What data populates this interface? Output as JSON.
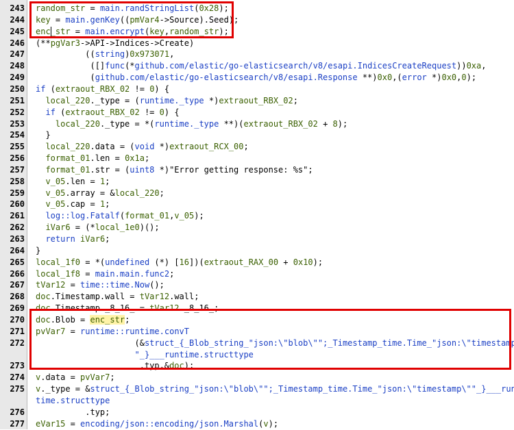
{
  "lines": [
    {
      "n": "243",
      "segs": [
        [
          "random_str",
          "t-var"
        ],
        [
          " = ",
          ""
        ],
        [
          "main.randStringList",
          "t-func"
        ],
        [
          "(",
          ""
        ],
        [
          "0x28",
          "t-num"
        ],
        [
          ");",
          ""
        ]
      ]
    },
    {
      "n": "244",
      "segs": [
        [
          "key",
          "t-var"
        ],
        [
          " = ",
          ""
        ],
        [
          "main.genKey",
          "t-func"
        ],
        [
          "((",
          ""
        ],
        [
          "pmVar4",
          "t-var"
        ],
        [
          "->Source).Seed);",
          ""
        ]
      ]
    },
    {
      "n": "245",
      "segs": [
        [
          "enc_str",
          "t-var"
        ],
        [
          " = ",
          ""
        ],
        [
          "main.encrypt",
          "t-func"
        ],
        [
          "(",
          ""
        ],
        [
          "key",
          "t-var"
        ],
        [
          ",",
          ""
        ],
        [
          "random_str",
          "t-var"
        ],
        [
          ");",
          ""
        ]
      ]
    },
    {
      "n": "246",
      "segs": [
        [
          "(**",
          ""
        ],
        [
          "pgVar3",
          "t-var"
        ],
        [
          "->API->Indices->Create)",
          ""
        ]
      ]
    },
    {
      "n": "247",
      "segs": [
        [
          "          ((",
          ""
        ],
        [
          "string",
          "t-type"
        ],
        [
          ")",
          ""
        ],
        [
          "0x973071",
          "t-num"
        ],
        [
          ",",
          ""
        ]
      ]
    },
    {
      "n": "248",
      "segs": [
        [
          "           ([]",
          ""
        ],
        [
          "func",
          "t-kw"
        ],
        [
          "(*",
          ""
        ],
        [
          "github.com/elastic/go-elasticsearch/v8/esapi.IndicesCreateRequest",
          "t-type"
        ],
        [
          "))",
          ""
        ],
        [
          "0xa",
          "t-num"
        ],
        [
          ",",
          ""
        ]
      ]
    },
    {
      "n": "249",
      "segs": [
        [
          "           (",
          ""
        ],
        [
          "github.com/elastic/go-elasticsearch/v8/esapi.Response",
          "t-type"
        ],
        [
          " **)",
          ""
        ],
        [
          "0x0",
          "t-num"
        ],
        [
          ",(",
          ""
        ],
        [
          "error",
          "t-type"
        ],
        [
          " *)",
          ""
        ],
        [
          "0x0",
          "t-num"
        ],
        [
          ",",
          ""
        ],
        [
          "0",
          "t-num"
        ],
        [
          ");",
          ""
        ]
      ]
    },
    {
      "n": "250",
      "segs": [
        [
          "if",
          "t-kw"
        ],
        [
          " (",
          ""
        ],
        [
          "extraout_RBX_02",
          "t-var"
        ],
        [
          " != ",
          ""
        ],
        [
          "0",
          "t-num"
        ],
        [
          ") {",
          ""
        ]
      ]
    },
    {
      "n": "251",
      "segs": [
        [
          "  ",
          ""
        ],
        [
          "local_220",
          "t-var"
        ],
        [
          "._type = (",
          ""
        ],
        [
          "runtime._type",
          "t-type"
        ],
        [
          " *)",
          ""
        ],
        [
          "extraout_RBX_02",
          "t-var"
        ],
        [
          ";",
          ""
        ]
      ]
    },
    {
      "n": "252",
      "segs": [
        [
          "  ",
          ""
        ],
        [
          "if",
          "t-kw"
        ],
        [
          " (",
          ""
        ],
        [
          "extraout_RBX_02",
          "t-var"
        ],
        [
          " != ",
          ""
        ],
        [
          "0",
          "t-num"
        ],
        [
          ") {",
          ""
        ]
      ]
    },
    {
      "n": "253",
      "segs": [
        [
          "    ",
          ""
        ],
        [
          "local_220",
          "t-var"
        ],
        [
          "._type = *(",
          ""
        ],
        [
          "runtime._type",
          "t-type"
        ],
        [
          " **)(",
          ""
        ],
        [
          "extraout_RBX_02",
          "t-var"
        ],
        [
          " + ",
          ""
        ],
        [
          "8",
          "t-num"
        ],
        [
          ");",
          ""
        ]
      ]
    },
    {
      "n": "254",
      "segs": [
        [
          "  }",
          ""
        ]
      ]
    },
    {
      "n": "255",
      "segs": [
        [
          "  ",
          ""
        ],
        [
          "local_220",
          "t-var"
        ],
        [
          ".data = (",
          ""
        ],
        [
          "void",
          "t-type"
        ],
        [
          " *)",
          ""
        ],
        [
          "extraout_RCX_00",
          "t-var"
        ],
        [
          ";",
          ""
        ]
      ]
    },
    {
      "n": "256",
      "segs": [
        [
          "  ",
          ""
        ],
        [
          "format_01",
          "t-var"
        ],
        [
          ".len = ",
          ""
        ],
        [
          "0x1a",
          "t-num"
        ],
        [
          ";",
          ""
        ]
      ]
    },
    {
      "n": "257",
      "segs": [
        [
          "  ",
          ""
        ],
        [
          "format_01",
          "t-var"
        ],
        [
          ".str = (",
          ""
        ],
        [
          "uint8",
          "t-type"
        ],
        [
          " *)\"Error getting response: %s\";",
          ""
        ]
      ]
    },
    {
      "n": "258",
      "segs": [
        [
          "  ",
          ""
        ],
        [
          "v_05",
          "t-var"
        ],
        [
          ".len = ",
          ""
        ],
        [
          "1",
          "t-num"
        ],
        [
          ";",
          ""
        ]
      ]
    },
    {
      "n": "259",
      "segs": [
        [
          "  ",
          ""
        ],
        [
          "v_05",
          "t-var"
        ],
        [
          ".array = &",
          ""
        ],
        [
          "local_220",
          "t-var"
        ],
        [
          ";",
          ""
        ]
      ]
    },
    {
      "n": "260",
      "segs": [
        [
          "  ",
          ""
        ],
        [
          "v_05",
          "t-var"
        ],
        [
          ".cap = ",
          ""
        ],
        [
          "1",
          "t-num"
        ],
        [
          ";",
          ""
        ]
      ]
    },
    {
      "n": "261",
      "segs": [
        [
          "  ",
          ""
        ],
        [
          "log::log.Fatalf",
          "t-func"
        ],
        [
          "(",
          ""
        ],
        [
          "format_01",
          "t-var"
        ],
        [
          ",",
          ""
        ],
        [
          "v_05",
          "t-var"
        ],
        [
          ");",
          ""
        ]
      ]
    },
    {
      "n": "262",
      "segs": [
        [
          "  ",
          ""
        ],
        [
          "iVar6",
          "t-var"
        ],
        [
          " = (*",
          ""
        ],
        [
          "local_1e0",
          "t-var"
        ],
        [
          ")();",
          ""
        ]
      ]
    },
    {
      "n": "263",
      "segs": [
        [
          "  ",
          ""
        ],
        [
          "return",
          "t-kw"
        ],
        [
          " ",
          ""
        ],
        [
          "iVar6",
          "t-var"
        ],
        [
          ";",
          ""
        ]
      ]
    },
    {
      "n": "264",
      "segs": [
        [
          "}",
          ""
        ]
      ]
    },
    {
      "n": "265",
      "segs": [
        [
          "local_1f0",
          "t-var"
        ],
        [
          " = *(",
          ""
        ],
        [
          "undefined",
          "t-type"
        ],
        [
          " (*) [",
          ""
        ],
        [
          "16",
          "t-num"
        ],
        [
          "])(",
          ""
        ],
        [
          "extraout_RAX_00",
          "t-var"
        ],
        [
          " + ",
          ""
        ],
        [
          "0x10",
          "t-num"
        ],
        [
          ");",
          ""
        ]
      ]
    },
    {
      "n": "266",
      "segs": [
        [
          "local_1f8",
          "t-var"
        ],
        [
          " = ",
          ""
        ],
        [
          "main.main.func2",
          "t-func"
        ],
        [
          ";",
          ""
        ]
      ]
    },
    {
      "n": "267",
      "segs": [
        [
          "tVar12",
          "t-var"
        ],
        [
          " = ",
          ""
        ],
        [
          "time::time.Now",
          "t-func"
        ],
        [
          "();",
          ""
        ]
      ]
    },
    {
      "n": "268",
      "segs": [
        [
          "doc",
          "t-var"
        ],
        [
          ".Timestamp.wall = ",
          ""
        ],
        [
          "tVar12",
          "t-var"
        ],
        [
          ".wall;",
          ""
        ]
      ]
    },
    {
      "n": "269",
      "segs": [
        [
          "doc",
          "t-var"
        ],
        [
          ".Timestamp._8_16_ = ",
          ""
        ],
        [
          "tVar12",
          "t-var"
        ],
        [
          "._8_16_;",
          ""
        ]
      ]
    },
    {
      "n": "270",
      "segs": [
        [
          "doc",
          "t-var"
        ],
        [
          ".Blob = ",
          ""
        ],
        [
          "enc_str",
          "t-var enc-hl"
        ],
        [
          ";",
          ""
        ]
      ]
    },
    {
      "n": "271",
      "segs": [
        [
          "pvVar7",
          "t-var"
        ],
        [
          " = ",
          ""
        ],
        [
          "runtime::runtime.convT",
          "t-func"
        ]
      ]
    },
    {
      "n": "272",
      "segs": [
        [
          "                    (&",
          ""
        ],
        [
          "struct_{_Blob_string_\"json:\\\"blob\\\"\";_Timestamp_time.Time_\"json:\\\"timestamp\\\"",
          "t-type"
        ]
      ]
    },
    {
      "n": "",
      "segs": [
        [
          "                    ",
          ""
        ],
        [
          "\"_}___runtime.structtype",
          "t-type"
        ]
      ]
    },
    {
      "n": "273",
      "segs": [
        [
          "                     .typ,&",
          ""
        ],
        [
          "doc",
          "t-var"
        ],
        [
          ");",
          ""
        ]
      ]
    },
    {
      "n": "274",
      "segs": [
        [
          "v",
          "t-var"
        ],
        [
          ".data = ",
          ""
        ],
        [
          "pvVar7",
          "t-var"
        ],
        [
          ";",
          ""
        ]
      ]
    },
    {
      "n": "275",
      "segs": [
        [
          "v",
          "t-var"
        ],
        [
          "._type = &",
          ""
        ],
        [
          "struct_{_Blob_string_\"json:\\\"blob\\\"\";_Timestamp_time.Time_\"json:\\\"timestamp\\\"\"_}___run",
          "t-type"
        ]
      ]
    },
    {
      "n": "",
      "segs": [
        [
          "time.structtype",
          "t-type"
        ]
      ]
    },
    {
      "n": "276",
      "segs": [
        [
          "          .typ;",
          ""
        ]
      ]
    },
    {
      "n": "277",
      "segs": [
        [
          "eVar15",
          "t-var"
        ],
        [
          " = ",
          ""
        ],
        [
          "encoding/json::encoding/json.Marshal",
          "t-func"
        ],
        [
          "(",
          ""
        ],
        [
          "v",
          "t-var"
        ],
        [
          ");",
          ""
        ]
      ]
    }
  ]
}
